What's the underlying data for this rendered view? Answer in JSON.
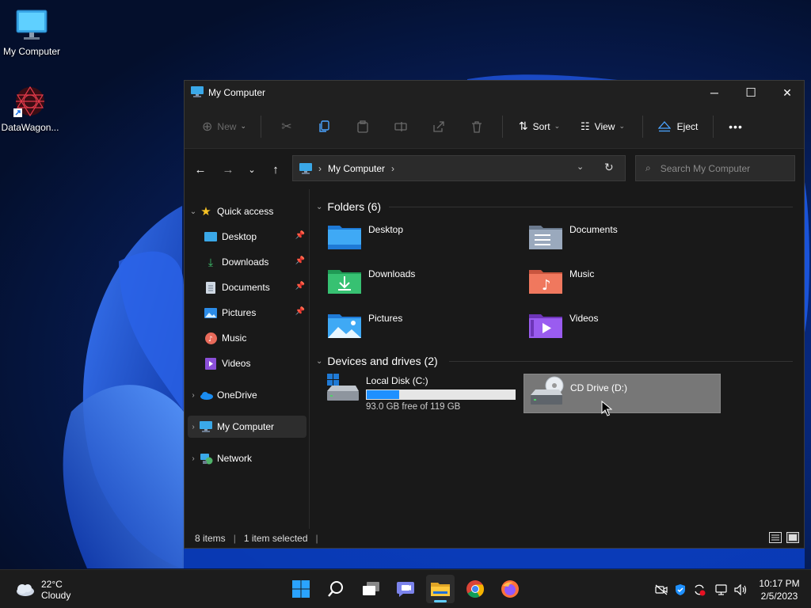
{
  "desktop": {
    "icons": [
      {
        "label": "My Computer",
        "icon": "monitor-icon"
      },
      {
        "label": "DataWagon...",
        "icon": "datawagon-shortcut-icon"
      }
    ]
  },
  "window": {
    "title": "My Computer",
    "controls": {
      "minimize": "─",
      "maximize": "☐",
      "close": "✕"
    },
    "toolbar": {
      "new_label": "New",
      "sort_label": "Sort",
      "view_label": "View",
      "eject_label": "Eject",
      "more_label": "•••"
    },
    "address": {
      "path": "My Computer",
      "search_placeholder": "Search My Computer"
    },
    "sidebar": {
      "quick_access": "Quick access",
      "items": [
        {
          "label": "Desktop",
          "pinned": true
        },
        {
          "label": "Downloads",
          "pinned": true
        },
        {
          "label": "Documents",
          "pinned": true
        },
        {
          "label": "Pictures",
          "pinned": true
        },
        {
          "label": "Music",
          "pinned": false
        },
        {
          "label": "Videos",
          "pinned": false
        }
      ],
      "onedrive": "OneDrive",
      "my_computer": "My Computer",
      "network": "Network"
    },
    "content": {
      "folders_header": "Folders (6)",
      "folders": [
        {
          "name": "Desktop",
          "icon": "desktop-folder-icon"
        },
        {
          "name": "Documents",
          "icon": "documents-folder-icon"
        },
        {
          "name": "Downloads",
          "icon": "downloads-folder-icon"
        },
        {
          "name": "Music",
          "icon": "music-folder-icon"
        },
        {
          "name": "Pictures",
          "icon": "pictures-folder-icon"
        },
        {
          "name": "Videos",
          "icon": "videos-folder-icon"
        }
      ],
      "drives_header": "Devices and drives (2)",
      "drives": [
        {
          "name": "Local Disk (C:)",
          "free_text": "93.0 GB free of 119 GB",
          "used_fraction": 0.22
        },
        {
          "name": "CD Drive (D:)",
          "selected": true
        }
      ]
    },
    "status": {
      "items": "8 items",
      "selected": "1 item selected"
    }
  },
  "taskbar": {
    "weather": {
      "temp": "22°C",
      "condition": "Cloudy"
    },
    "clock": {
      "time": "10:17 PM",
      "date": "2/5/2023"
    }
  },
  "colors": {
    "accent": "#1e90ff",
    "selected_drive_bg": "#777777",
    "window_bg": "#191919"
  }
}
